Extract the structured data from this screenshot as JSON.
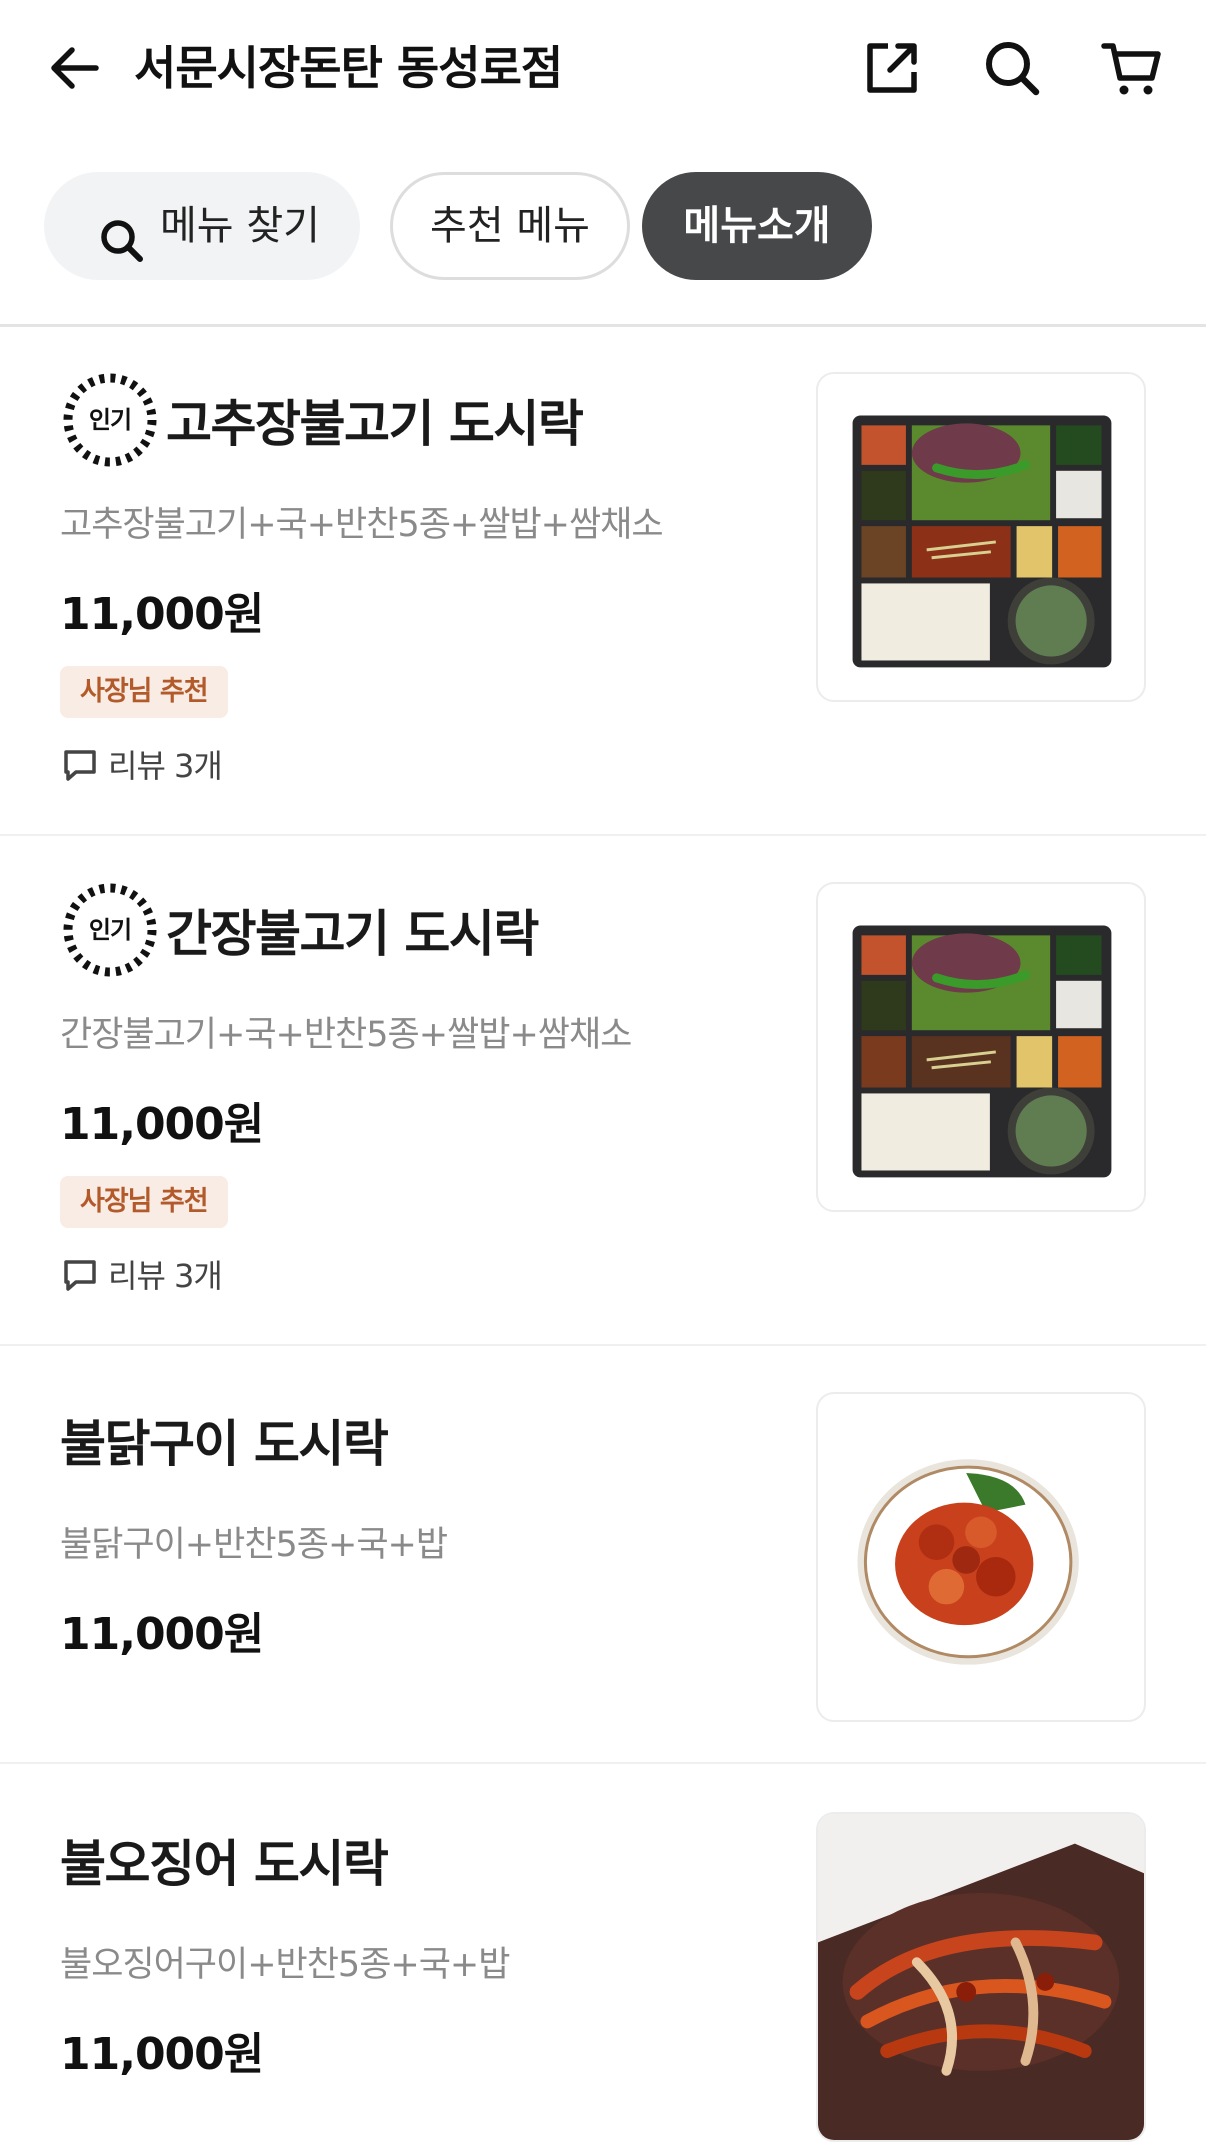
{
  "header": {
    "title": "서문시장돈탄 동성로점",
    "back_icon": "arrow-left-icon",
    "share_icon": "share-icon",
    "search_icon": "search-icon",
    "cart_icon": "cart-icon"
  },
  "chips": {
    "search": "메뉴 찾기",
    "recommended": "추천 메뉴",
    "intro": "메뉴소개"
  },
  "badges": {
    "popular": "인기",
    "owner_pick": "사장님 추천"
  },
  "colors": {
    "active_chip": "#46484a",
    "owner_tag_bg": "#f8ece4",
    "owner_tag_text": "#b35a2b",
    "description_text": "#8a8a8a"
  },
  "menu": [
    {
      "name": "고추장불고기 도시락",
      "description": "고추장불고기+국+반찬5종+쌀밥+쌈채소",
      "price": "11,000원",
      "review": "리뷰 3개"
    },
    {
      "name": "간장불고기 도시락",
      "description": "간장불고기+국+반찬5종+쌀밥+쌈채소",
      "price": "11,000원",
      "review": "리뷰 3개"
    },
    {
      "name": "불닭구이 도시락",
      "description": "불닭구이+반찬5종+국+밥",
      "price": "11,000원"
    },
    {
      "name": "불오징어 도시락",
      "description": "불오징어구이+반찬5종+국+밥",
      "price": "11,000원"
    }
  ]
}
